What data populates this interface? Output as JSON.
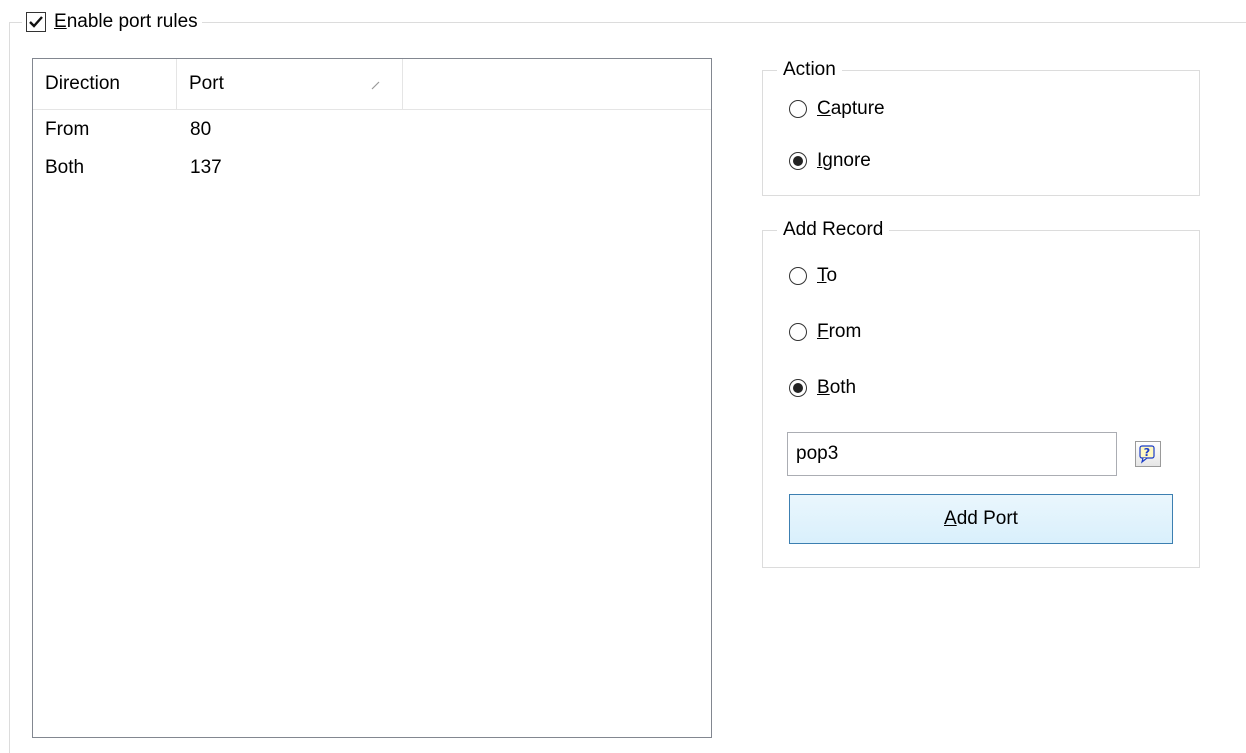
{
  "port_rules": {
    "enable_checkbox": {
      "checked": true,
      "label_mnemonic": "E",
      "label_rest": "nable port rules"
    }
  },
  "list": {
    "columns": [
      {
        "label": "Direction"
      },
      {
        "label": "Port",
        "sorted": true
      }
    ],
    "rows": [
      {
        "direction": "From",
        "port": "80"
      },
      {
        "direction": "Both",
        "port": "137"
      }
    ]
  },
  "action": {
    "legend": "Action",
    "options": [
      {
        "mnemonic": "C",
        "rest": "apture",
        "selected": false
      },
      {
        "mnemonic": "I",
        "rest": "gnore",
        "selected": true
      }
    ]
  },
  "add_record": {
    "legend": "Add Record",
    "options": [
      {
        "mnemonic": "T",
        "rest": "o",
        "selected": false
      },
      {
        "mnemonic": "F",
        "rest": "rom",
        "selected": false
      },
      {
        "mnemonic": "B",
        "rest": "oth",
        "selected": true
      }
    ],
    "port_input_value": "pop3",
    "help_icon": "help-balloon-icon",
    "add_button_mnemonic": "A",
    "add_button_rest": "dd Port"
  },
  "colors": {
    "border": "#828790",
    "button_border": "#3c7fb1",
    "button_fill": "#e5f1fb",
    "help_icon": "#1a3cc8"
  }
}
